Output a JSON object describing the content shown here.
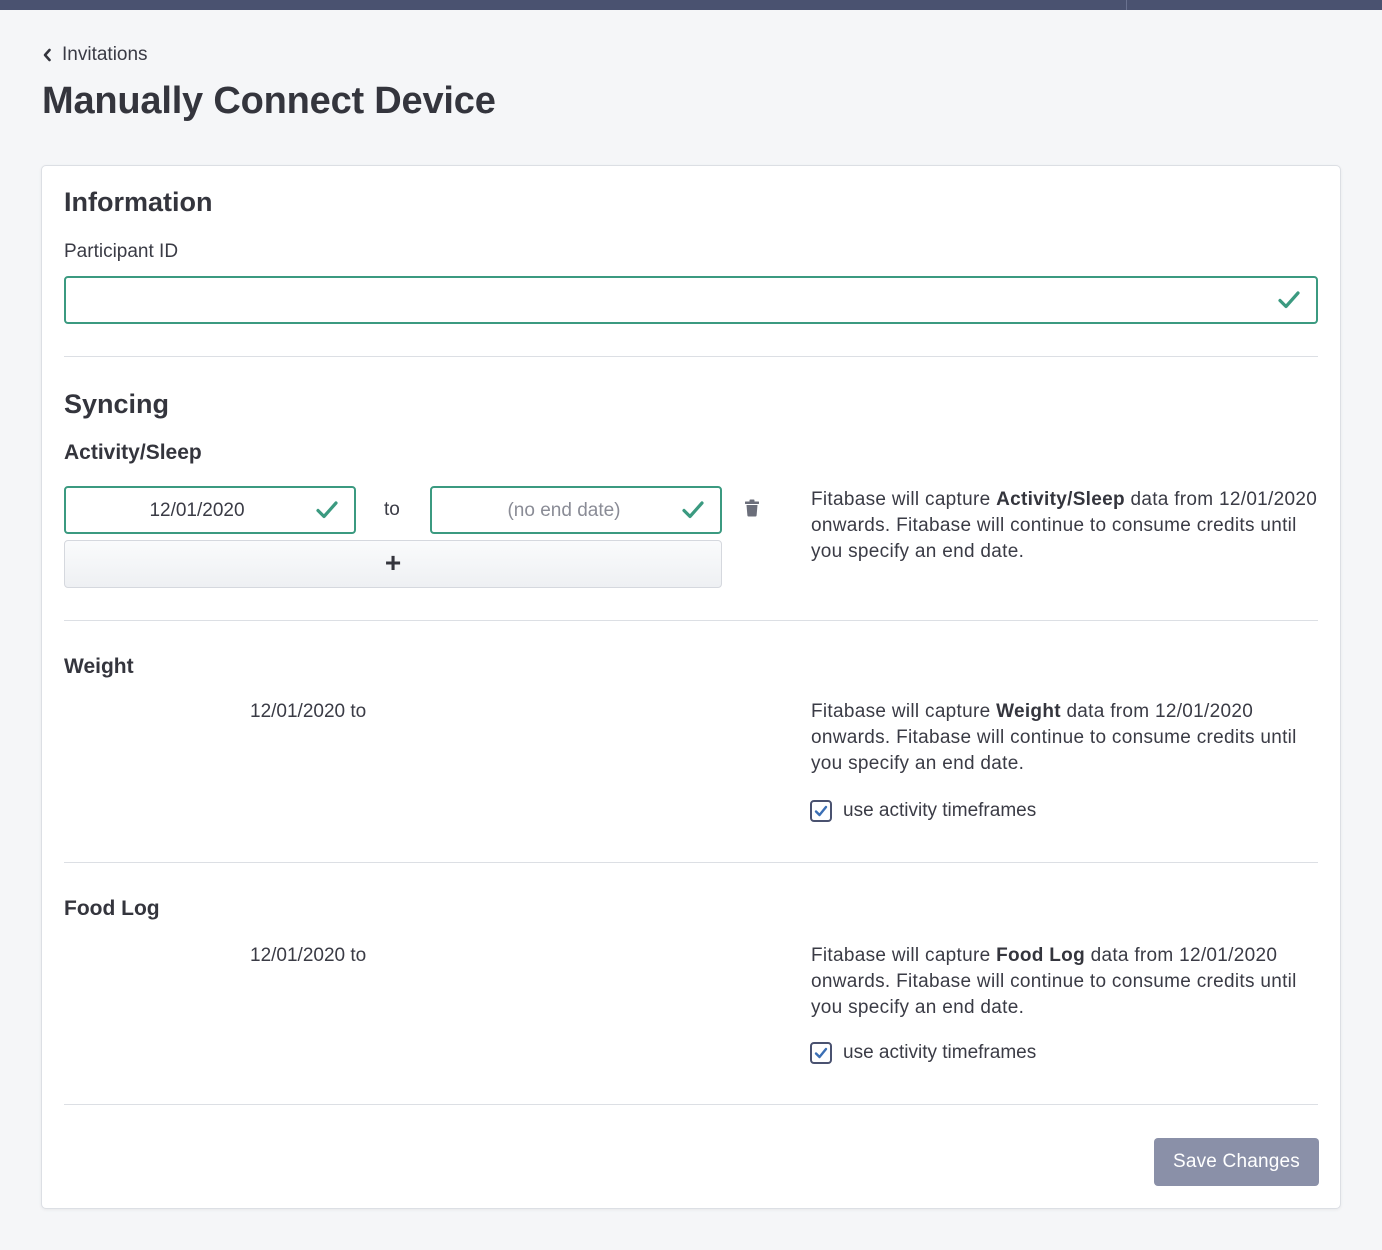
{
  "breadcrumb": {
    "label": "Invitations"
  },
  "page": {
    "title": "Manually Connect Device"
  },
  "information": {
    "title": "Information",
    "participant_id_label": "Participant ID",
    "participant_id_value": ""
  },
  "syncing": {
    "title": "Syncing",
    "activity_sleep": {
      "title": "Activity/Sleep",
      "start_date": "12/01/2020",
      "to_label": "to",
      "end_date_placeholder": "(no end date)",
      "add_label": "+",
      "help_prefix": "Fitabase will capture ",
      "help_bold": "Activity/Sleep",
      "help_suffix": " data from 12/01/2020 onwards. Fitabase will continue to consume credits until you specify an end date."
    },
    "weight": {
      "title": "Weight",
      "date_range": "12/01/2020 to",
      "help_prefix": "Fitabase will capture ",
      "help_bold": "Weight",
      "help_suffix": " data from 12/01/2020 onwards. Fitabase will continue to consume credits until you specify an end date.",
      "checkbox_label": "use activity timeframes",
      "checked": true
    },
    "food_log": {
      "title": "Food Log",
      "date_range": "12/01/2020 to",
      "help_prefix": "Fitabase will capture ",
      "help_bold": "Food Log",
      "help_suffix": " data from 12/01/2020 onwards. Fitabase will continue to consume credits until you specify an end date.",
      "checkbox_label": "use activity timeframes",
      "checked": true
    }
  },
  "actions": {
    "save_label": "Save Changes"
  },
  "colors": {
    "topbar": "#4a5270",
    "valid_border": "#3b9a80",
    "save_button": "#8a90a8",
    "background": "#f5f6f8"
  },
  "icons": {
    "back": "chevron-left-icon",
    "valid": "check-icon",
    "delete": "trash-icon",
    "checkbox": "checkbox-checked-icon"
  }
}
